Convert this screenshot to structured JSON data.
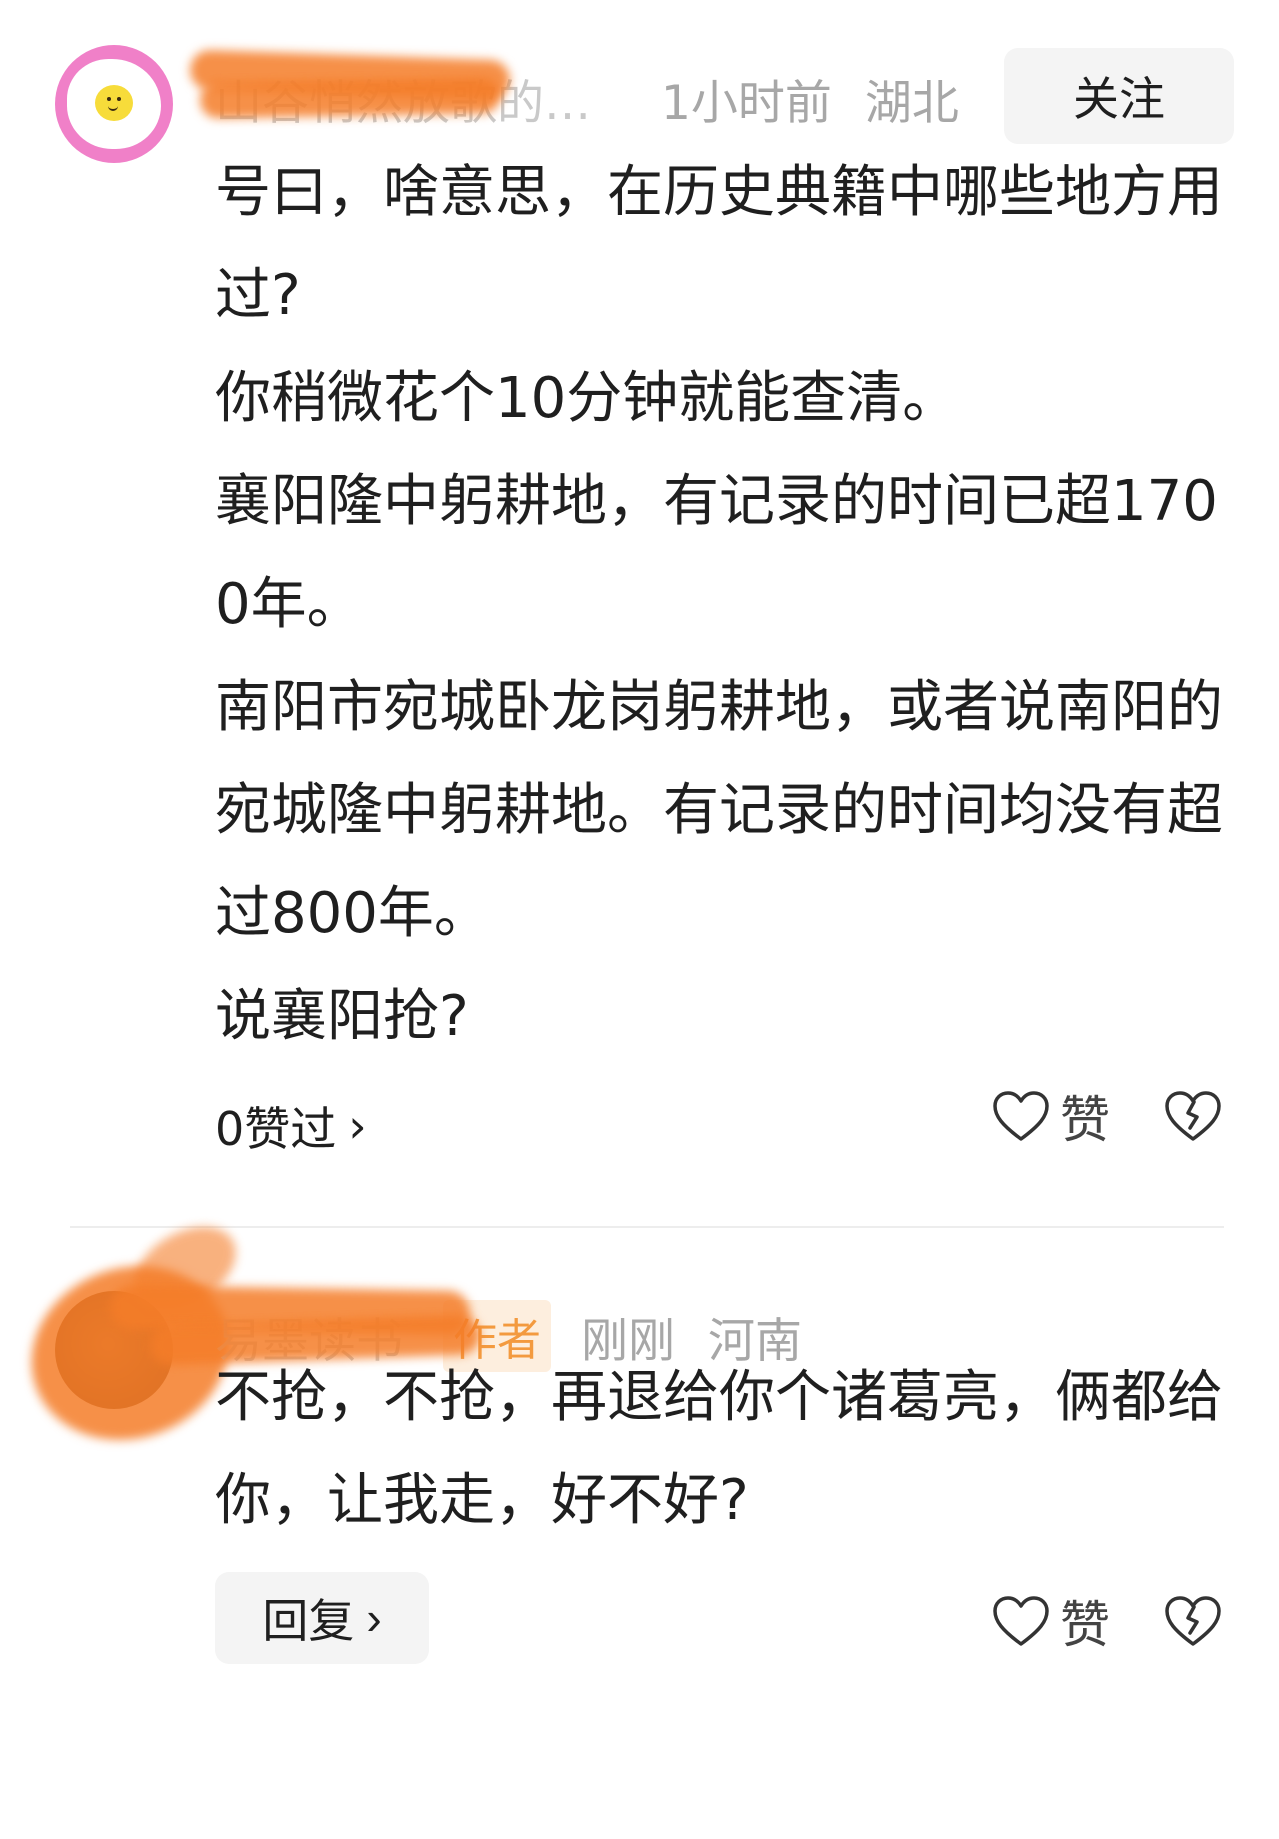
{
  "comments": [
    {
      "username": "山谷悄然放歌的…",
      "time": "1小时前",
      "location": "湖北",
      "follow_label": "关注",
      "lines": [
        "号曰，啥意思，在历史典籍中哪些地方用过?",
        "你稍微花个10分钟就能查清。",
        "襄阳隆中躬耕地，有记录的时间已超1700年。",
        "南阳市宛城卧龙岗躬耕地，或者说南阳的宛城隆中躬耕地。有记录的时间均没有超过800年。",
        "说襄阳抢?"
      ],
      "likes_summary": "0赞过",
      "like_label": "赞"
    },
    {
      "username": "易墨读书",
      "author_badge": "作者",
      "time": "刚刚",
      "location": "河南",
      "lines": [
        "不抢，不抢，再退给你个诸葛亮，俩都给你，让我走，好不好?"
      ],
      "reply_label": "回复",
      "like_label": "赞"
    }
  ],
  "icons": {
    "heart": "heart-icon",
    "dislike": "broken-heart-icon",
    "chevron": "chevron-right-icon"
  },
  "colors": {
    "redaction": "#f47c28",
    "avatar_ring": "#f080c8",
    "author_badge": "#f39a3f"
  }
}
